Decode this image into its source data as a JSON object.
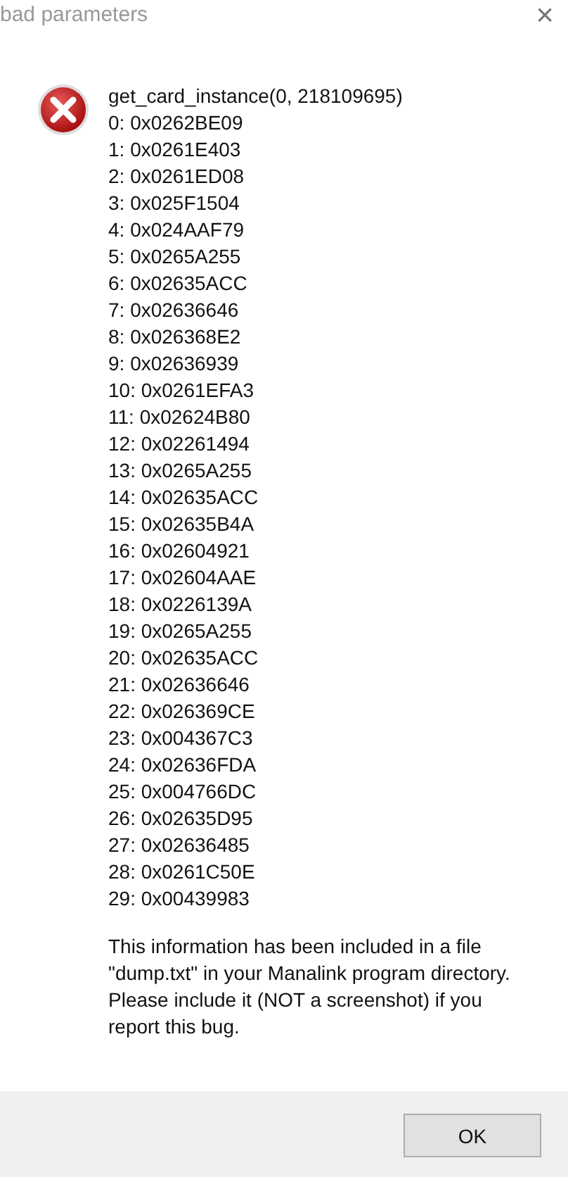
{
  "window": {
    "title": "bad parameters",
    "close": "×"
  },
  "message": {
    "kind": "error",
    "header": "get_card_instance(0, 218109695)",
    "lines": [
      "0: 0x0262BE09",
      "1: 0x0261E403",
      "2: 0x0261ED08",
      "3: 0x025F1504",
      "4: 0x024AAF79",
      "5: 0x0265A255",
      "6: 0x02635ACC",
      "7: 0x02636646",
      "8: 0x026368E2",
      "9: 0x02636939",
      "10: 0x0261EFA3",
      "11: 0x02624B80",
      "12: 0x02261494",
      "13: 0x0265A255",
      "14: 0x02635ACC",
      "15: 0x02635B4A",
      "16: 0x02604921",
      "17: 0x02604AAE",
      "18: 0x0226139A",
      "19: 0x0265A255",
      "20: 0x02635ACC",
      "21: 0x02636646",
      "22: 0x026369CE",
      "23: 0x004367C3",
      "24: 0x02636FDA",
      "25: 0x004766DC",
      "26: 0x02635D95",
      "27: 0x02636485",
      "28: 0x0261C50E",
      "29: 0x00439983"
    ],
    "note": "This information has been included in a file\n\"dump.txt\" in your Manalink program directory.\nPlease include it (NOT a screenshot) if you\nreport this bug."
  },
  "buttons": [
    "OK"
  ]
}
